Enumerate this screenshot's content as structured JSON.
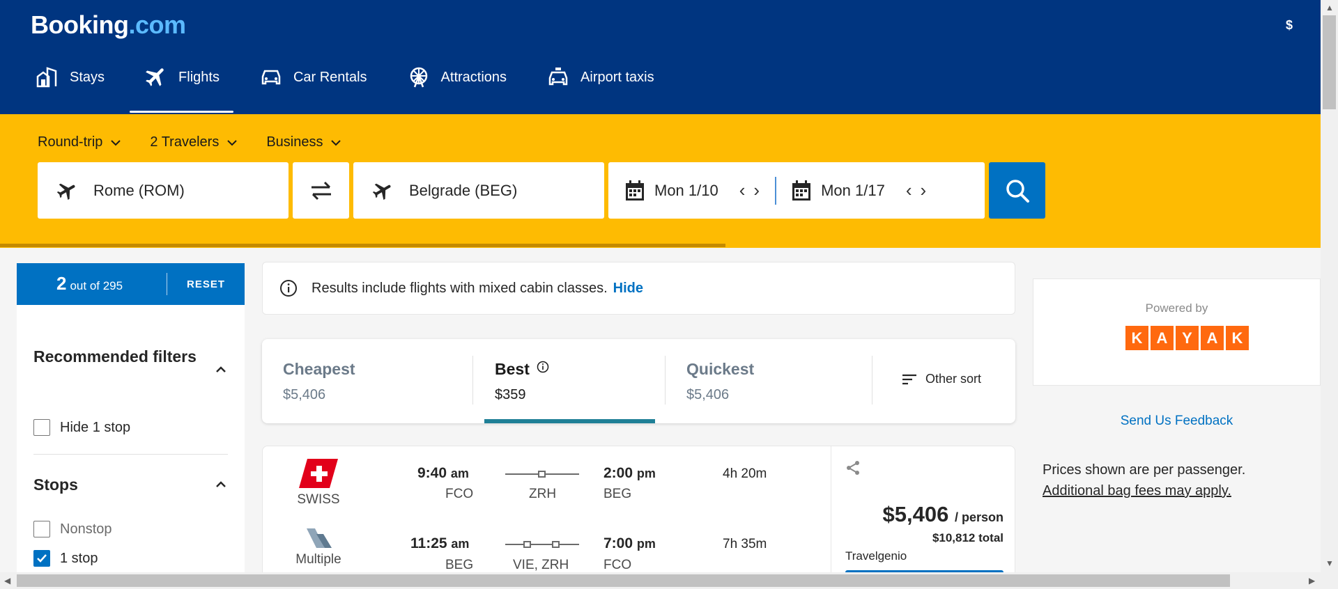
{
  "header": {
    "logo_main": "Booking",
    "logo_suffix": ".com",
    "currency": "$",
    "nav": [
      {
        "label": "Stays",
        "icon": "stays-icon"
      },
      {
        "label": "Flights",
        "icon": "plane-icon",
        "active": true
      },
      {
        "label": "Car Rentals",
        "icon": "car-icon"
      },
      {
        "label": "Attractions",
        "icon": "ferris-wheel-icon"
      },
      {
        "label": "Airport taxis",
        "icon": "taxi-icon"
      }
    ]
  },
  "search": {
    "trip_type": "Round-trip",
    "travelers": "2 Travelers",
    "cabin": "Business",
    "from": "Rome (ROM)",
    "to": "Belgrade (BEG)",
    "depart": "Mon 1/10",
    "return": "Mon 1/17"
  },
  "filters": {
    "count_num": "2",
    "count_text": "out of 295",
    "reset": "RESET",
    "recommended_title": "Recommended filters",
    "hide_stop": "Hide 1 stop",
    "stops_title": "Stops",
    "nonstop": "Nonstop",
    "one_stop": "1 stop"
  },
  "info": {
    "text": "Results include flights with mixed cabin classes.",
    "hide": "Hide"
  },
  "sort": {
    "tabs": [
      {
        "title": "Cheapest",
        "price": "$5,406"
      },
      {
        "title": "Best",
        "price": "$359"
      },
      {
        "title": "Quickest",
        "price": "$5,406"
      }
    ],
    "other": "Other sort"
  },
  "result": {
    "outbound": {
      "airline": "SWISS",
      "dep_time": "9:40",
      "dep_ampm": "am",
      "dep_code": "FCO",
      "via": "ZRH",
      "arr_time": "2:00",
      "arr_ampm": "pm",
      "arr_code": "BEG",
      "duration": "4h 20m"
    },
    "inbound": {
      "airline": "Multiple",
      "dep_time": "11:25",
      "dep_ampm": "am",
      "dep_code": "BEG",
      "via": "VIE, ZRH",
      "arr_time": "7:00",
      "arr_ampm": "pm",
      "arr_code": "FCO",
      "duration": "7h 35m"
    },
    "price": "$5,406",
    "per": "/ person",
    "total": "$10,812 total",
    "provider": "Travelgenio"
  },
  "sidebar": {
    "powered_by": "Powered by",
    "kayak_letters": [
      "K",
      "A",
      "Y",
      "A",
      "K"
    ],
    "feedback": "Send Us Feedback",
    "note1": "Prices shown are per passenger.",
    "note2": "Additional bag fees may apply."
  },
  "colors": {
    "brand_blue": "#003580",
    "accent_yellow": "#febb02",
    "action_blue": "#0071c2",
    "kayak_orange": "#ff690f"
  }
}
